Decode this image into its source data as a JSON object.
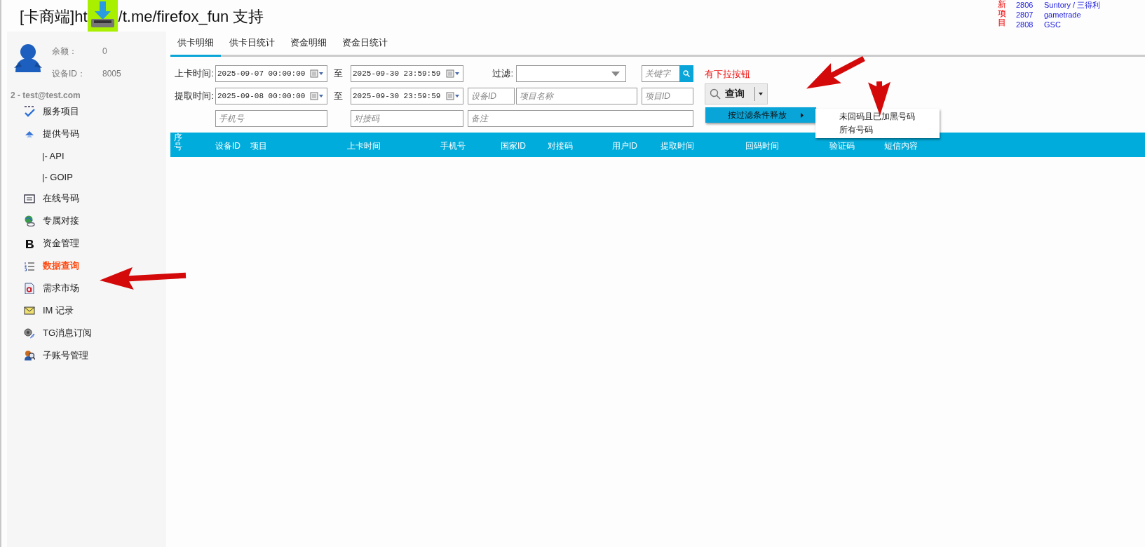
{
  "header": {
    "title_start": "[卡商端]ht",
    "title_end": "/t.me/firefox_fun 支持"
  },
  "news": {
    "label": "新项目",
    "items": [
      {
        "id": "2806",
        "name": "Suntory / 三得利"
      },
      {
        "id": "2807",
        "name": "gametrade"
      },
      {
        "id": "2808",
        "name": "GSC"
      }
    ]
  },
  "account": {
    "balance_label": "余额：",
    "balance": "0",
    "device_label": "设备ID：",
    "device_id": "8005",
    "user": "2 - test@test.com"
  },
  "menu": [
    {
      "label": "服务项目",
      "kind": "abc",
      "selected": false
    },
    {
      "label": "提供号码",
      "kind": "arrow",
      "selected": false,
      "children": [
        {
          "label": "|-  API",
          "selected": false
        },
        {
          "label": "|-  GOIP",
          "selected": false
        }
      ]
    },
    {
      "label": "在线号码",
      "kind": "list",
      "selected": false
    },
    {
      "label": "专属对接",
      "kind": "globe",
      "selected": false
    },
    {
      "label": "资金管理",
      "kind": "bold",
      "selected": false
    },
    {
      "label": "数据查询",
      "kind": "numbered",
      "selected": true
    },
    {
      "label": "需求市场",
      "kind": "doc",
      "selected": false
    },
    {
      "label": "IM 记录",
      "kind": "mail",
      "selected": false
    },
    {
      "label": "TG消息订阅",
      "kind": "speaker",
      "selected": false
    },
    {
      "label": "子账号管理",
      "kind": "people",
      "selected": false
    }
  ],
  "tabs": [
    {
      "label": "供卡明细",
      "selected": true
    },
    {
      "label": "供卡日统计",
      "selected": false
    },
    {
      "label": "资金明细",
      "selected": false
    },
    {
      "label": "资金日统计",
      "selected": false
    }
  ],
  "filters": {
    "upload_label": "上卡时间:",
    "upload_from": "2025-09-07 00:00:00",
    "to_label": "至",
    "upload_to": "2025-09-30 23:59:59",
    "filter_label": "过滤:",
    "keyword_placeholder": "关键字",
    "fetch_label": "提取时间:",
    "fetch_from": "2025-09-08 00:00:00",
    "to_label_2": "至",
    "fetch_to": "2025-09-30 23:59:59",
    "device_placeholder": "设备ID",
    "project_name_placeholder": "项目名称",
    "project_id_placeholder": "项目ID",
    "phone_placeholder": "手机号",
    "code_placeholder": "对接码",
    "note_placeholder": "备注"
  },
  "annotation": "有下拉按钮",
  "query_button": "查询",
  "dropdown_menu": {
    "item": "按过滤条件释放",
    "submenu": [
      "未回码且已加黑号码",
      "所有号码"
    ]
  },
  "table": {
    "columns": [
      "序号",
      "设备ID",
      "项目",
      "上卡时间",
      "手机号",
      "国家ID",
      "对接码",
      "用户ID",
      "提取时间",
      "回码时间",
      "验证码",
      "短信内容"
    ]
  }
}
